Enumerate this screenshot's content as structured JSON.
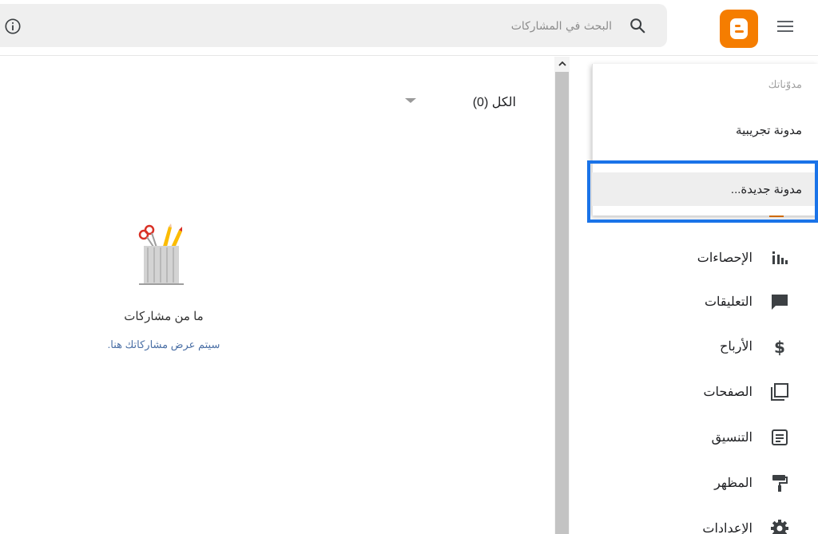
{
  "header": {
    "search_placeholder": "البحث في المشاركات",
    "icons": {
      "menu": "hamburger-menu-icon",
      "logo": "blogger-logo-icon",
      "search": "search-icon",
      "info": "info-icon"
    },
    "brand_color": "#f57d00"
  },
  "filter": {
    "label": "الكل (0)"
  },
  "empty_state": {
    "title": "ما من مشاركات",
    "subtitle": "سيتم عرض مشاركاتك هنا."
  },
  "sidebar": {
    "items": [
      {
        "label": "الإحصاءات",
        "icon": "stats-icon"
      },
      {
        "label": "التعليقات",
        "icon": "comments-icon"
      },
      {
        "label": "الأرباح",
        "icon": "dollar-icon"
      },
      {
        "label": "الصفحات",
        "icon": "pages-icon"
      },
      {
        "label": "التنسيق",
        "icon": "layout-icon"
      },
      {
        "label": "المظهر",
        "icon": "theme-paint-roller-icon"
      },
      {
        "label": "الإعدادات",
        "icon": "gear-icon"
      }
    ]
  },
  "blog_dropdown": {
    "header": "مدوّناتك",
    "blogs": [
      "مدونة تجريبية"
    ],
    "new_blog_label": "مدونة جديدة...",
    "highlight_color": "#1a73e8"
  }
}
